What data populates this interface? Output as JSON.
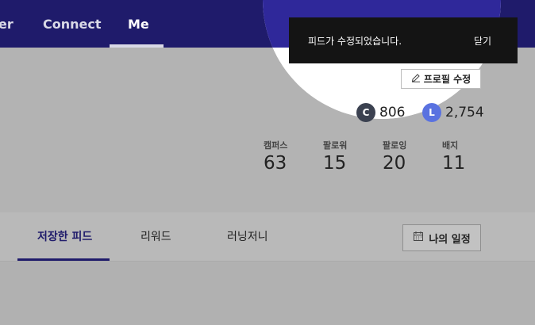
{
  "nav": {
    "items": [
      {
        "label": "er",
        "active": false
      },
      {
        "label": "Connect",
        "active": false
      },
      {
        "label": "Me",
        "active": true
      }
    ]
  },
  "toolbar": {
    "icons": [
      "pencil-icon",
      "search-icon",
      "book-icon",
      "bell-icon",
      "gear-icon"
    ]
  },
  "toast": {
    "message": "피드가 수정되었습니다.",
    "close_label": "닫기"
  },
  "profile": {
    "edit_label": "프로필 수정",
    "points": [
      {
        "badge": "C",
        "value": "806",
        "color": "#3b4150"
      },
      {
        "badge": "L",
        "value": "2,754",
        "color": "#5a72e0"
      }
    ],
    "stats": [
      {
        "label": "캠퍼스",
        "value": "63"
      },
      {
        "label": "팔로워",
        "value": "15"
      },
      {
        "label": "팔로잉",
        "value": "20"
      },
      {
        "label": "배지",
        "value": "11"
      }
    ]
  },
  "tabs": {
    "items": [
      {
        "label": "저장한 피드",
        "active": true
      },
      {
        "label": "리워드",
        "active": false
      },
      {
        "label": "러닝저니",
        "active": false
      }
    ],
    "schedule_label": "나의 일정"
  },
  "colors": {
    "nav_bg": "#1f1b6b",
    "accent": "#1f1b6b",
    "spotlight_nav": "#2f289a",
    "toast_bg": "#141414"
  }
}
